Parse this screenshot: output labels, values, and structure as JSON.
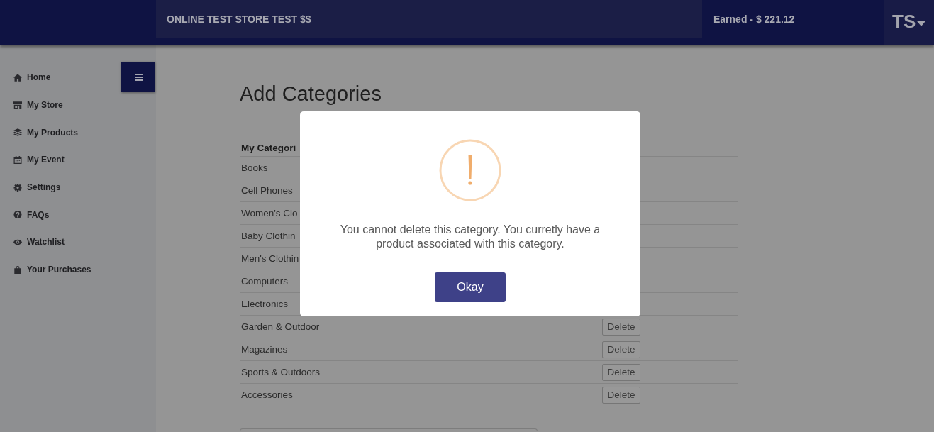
{
  "header": {
    "store_name": "ONLINE TEST STORE TEST $$",
    "earnings": "Earned - $ 221.12",
    "user_initials": "TS"
  },
  "sidebar": {
    "items": [
      {
        "label": "Home",
        "selected": false
      },
      {
        "label": "My Store",
        "selected": false
      },
      {
        "label": "My Products",
        "selected": false
      },
      {
        "label": "My Event",
        "selected": false
      },
      {
        "label": "Settings",
        "selected": false
      },
      {
        "label": "FAQs",
        "selected": false
      },
      {
        "label": "Watchlist",
        "selected": false
      },
      {
        "label": "Your Purchases",
        "selected": false
      }
    ]
  },
  "page": {
    "title": "Add Categories",
    "table": {
      "columns": [
        "My Categori"
      ],
      "rows": [
        {
          "name": "Books"
        },
        {
          "name": "Cell Phones"
        },
        {
          "name": "Women's Clo"
        },
        {
          "name": "Baby Clothin"
        },
        {
          "name": "Men's Clothin"
        },
        {
          "name": "Computers"
        },
        {
          "name": "Electronics"
        },
        {
          "name": "Garden & Outdoor",
          "action": "Delete"
        },
        {
          "name": "Magazines",
          "action": "Delete"
        },
        {
          "name": "Sports & Outdoors",
          "action": "Delete"
        },
        {
          "name": "Accessories",
          "action": "Delete"
        }
      ]
    }
  },
  "dialog": {
    "message": "You cannot delete this category. You curretly have a product associated with this category.",
    "button": "Okay"
  }
}
